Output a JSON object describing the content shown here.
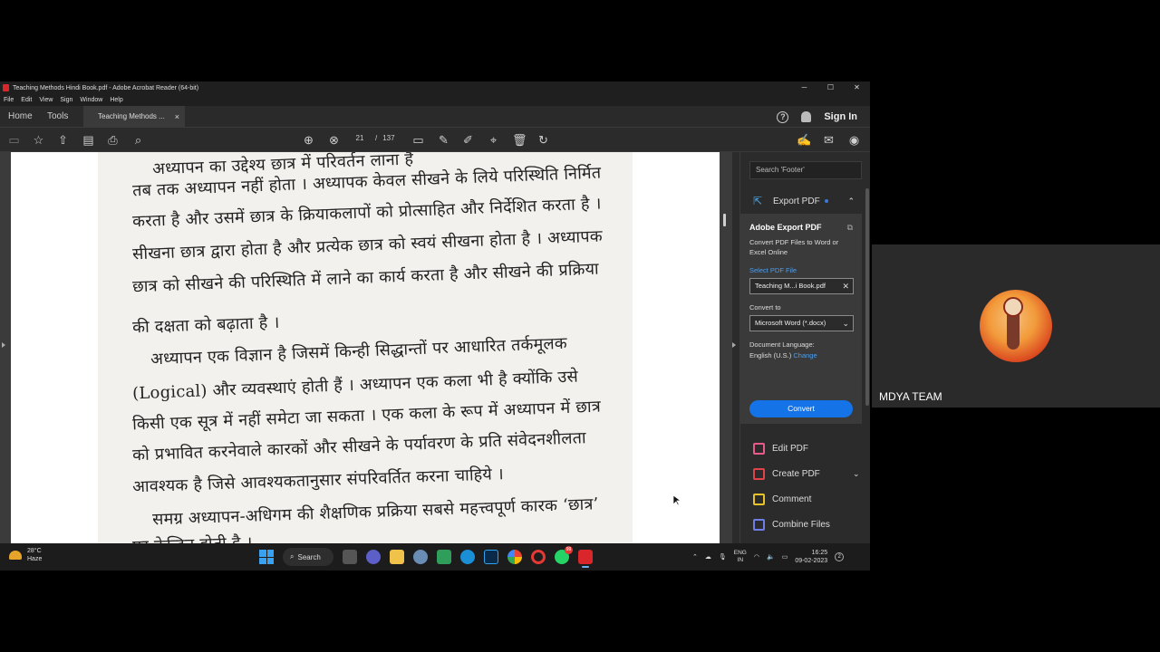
{
  "window": {
    "title": "Teaching Methods Hindi Book.pdf - Adobe Acrobat Reader (64-bit)",
    "controls": [
      "─",
      "☐",
      "✕"
    ]
  },
  "menu": [
    "File",
    "Edit",
    "View",
    "Sign",
    "Window",
    "Help"
  ],
  "tabs": {
    "home": "Home",
    "tools": "Tools",
    "document": "Teaching Methods ...",
    "close": "×",
    "help": "?",
    "signin": "Sign In"
  },
  "toolbar": {
    "page_current": "21",
    "page_sep": "/",
    "page_total": "137"
  },
  "document": {
    "lines": [
      "अध्यापन का उद्देश्य छात्र में परिवर्तन लाना है",
      "तब तक अध्यापन नहीं होता । अध्यापक केवल सीखने के लिये परिस्थिति निर्मित",
      "करता है और उसमें छात्र के क्रियाकलापों को प्रोत्साहित और निर्देशित करता है ।",
      "सीखना छात्र द्वारा होता है और प्रत्येक छात्र को स्वयं सीखना होता है । अध्यापक",
      "छात्र को सीखने की परिस्थिति में लाने का कार्य करता है और सीखने की प्रक्रिया",
      "की दक्षता को बढ़ाता है ।",
      "अध्यापन एक विज्ञान है जिसमें किन्ही सिद्धान्तों पर आधारित तर्कमूलक",
      "(Logical) और व्यवस्थाएं होती हैं । अध्यापन एक कला भी है क्योंकि उसे",
      "किसी एक सूत्र में नहीं समेटा जा सकता । एक कला के रूप में अध्यापन में छात्र",
      "को प्रभावित करनेवाले कारकों और सीखने के पर्यावरण के प्रति संवेदनशीलता",
      "आवश्यक है जिसे आवश्यकतानुसार संपरिवर्तित करना चाहिये ।",
      "समग्र अध्यापन-अधिगम की शैक्षणिक प्रक्रिया सबसे महत्त्वपूर्ण कारक ‘छात्र’",
      "पर केन्द्रित होती है ।"
    ]
  },
  "pane": {
    "search_placeholder": "Search 'Footer'",
    "export_label": "Export PDF",
    "card_title": "Adobe Export PDF",
    "card_desc": "Convert PDF Files to Word or Excel Online",
    "select_file": "Select PDF File",
    "file_name": "Teaching M...i Book.pdf",
    "convert_to": "Convert to",
    "format": "Microsoft Word (*.docx)",
    "doc_lang_label": "Document Language:",
    "doc_lang": "English (U.S.)",
    "change": "Change",
    "convert_button": "Convert",
    "tools": [
      {
        "label": "Edit PDF",
        "color": "#e85a8a"
      },
      {
        "label": "Create PDF",
        "color": "#e0444a"
      },
      {
        "label": "Comment",
        "color": "#e8c22a"
      },
      {
        "label": "Combine Files",
        "color": "#6f7de8"
      }
    ]
  },
  "taskbar": {
    "temp": "28°C",
    "condition": "Haze",
    "search": "Search",
    "whatsapp_badge": "99",
    "lang_top": "ENG",
    "lang_bottom": "IN",
    "time": "16:25",
    "date": "09-02-2023",
    "notif_count": "2"
  },
  "meeting": {
    "participant": "MDYA TEAM"
  }
}
